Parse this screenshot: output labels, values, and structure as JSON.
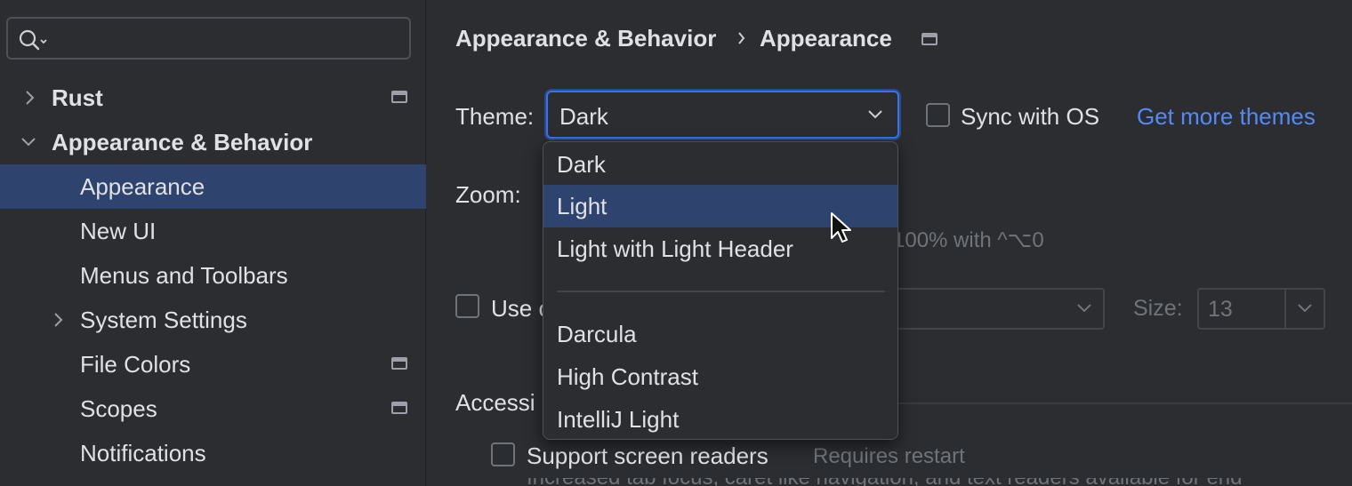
{
  "search": {
    "value": "",
    "placeholder": ""
  },
  "sidebar": {
    "items": [
      {
        "label": "Rust"
      },
      {
        "label": "Appearance & Behavior"
      },
      {
        "label": "Appearance"
      },
      {
        "label": "New UI"
      },
      {
        "label": "Menus and Toolbars"
      },
      {
        "label": "System Settings"
      },
      {
        "label": "File Colors"
      },
      {
        "label": "Scopes"
      },
      {
        "label": "Notifications"
      }
    ]
  },
  "breadcrumb": {
    "parent": "Appearance & Behavior",
    "separator": "›",
    "current": "Appearance"
  },
  "theme": {
    "label": "Theme:",
    "value": "Dark",
    "sync_label": "Sync with OS",
    "get_more_link": "Get more themes",
    "options": [
      "Dark",
      "Light",
      "Light with Light Header",
      "Darcula",
      "High Contrast",
      "IntelliJ Light"
    ],
    "highlighted": "Light"
  },
  "zoom": {
    "label": "Zoom:",
    "hint_fragment": "100% with ^⌥0"
  },
  "custom_font": {
    "label_fragment": "Use c",
    "size_label": "Size:",
    "size_value": "13"
  },
  "accessibility": {
    "header_fragment": "Accessi",
    "screen_readers_label": "Support screen readers",
    "requires_restart": "Requires restart",
    "cut_text": "Increased tab focus, caret like navigation, and text readers available for end"
  },
  "colors": {
    "accent": "#3574f0",
    "selection": "#2e436e",
    "link": "#548af7",
    "background": "#2b2d30"
  }
}
